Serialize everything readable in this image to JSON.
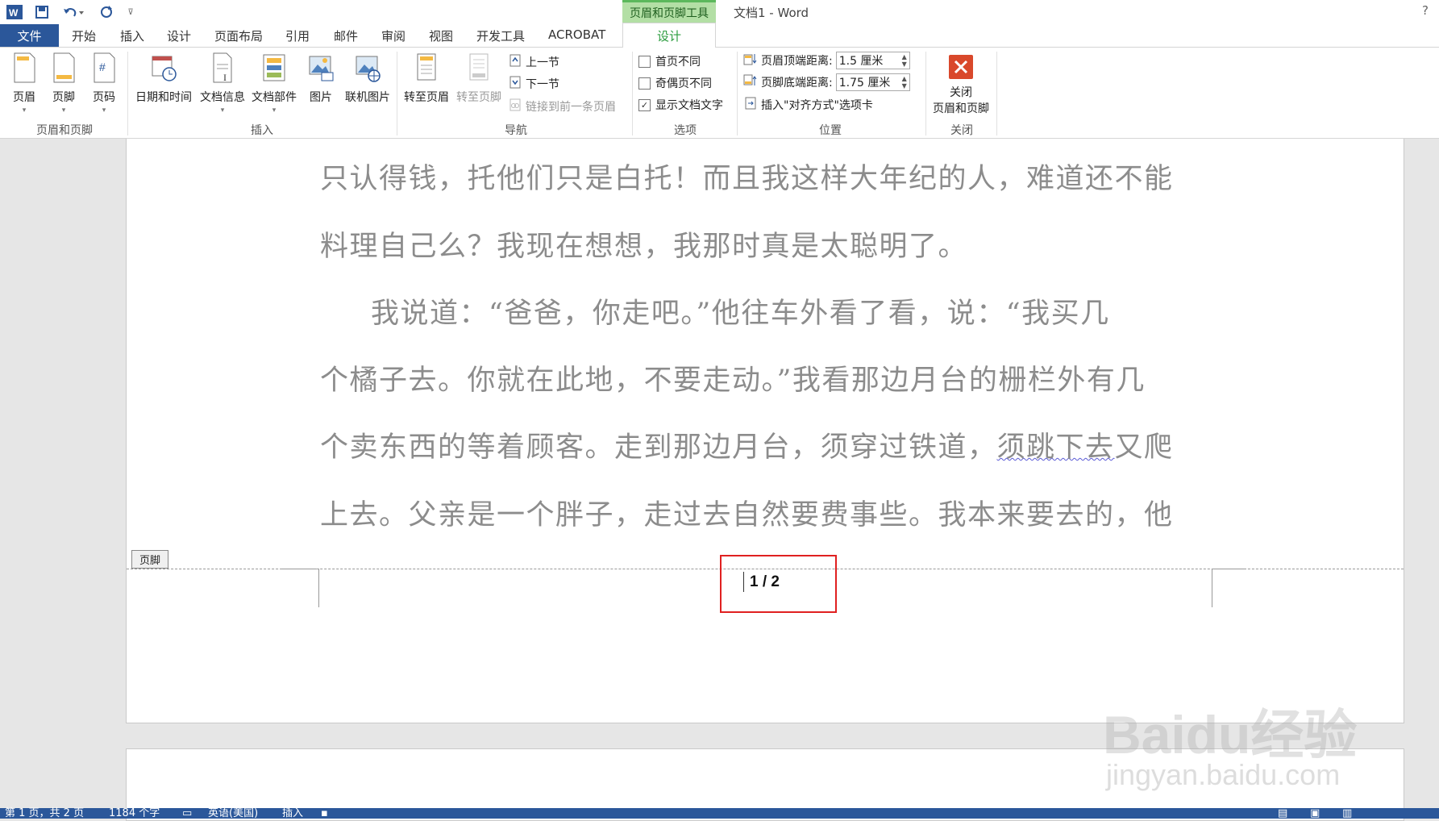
{
  "title_bar": {
    "app_title": "文档1 - Word",
    "context_group": "页眉和页脚工具",
    "help": "?",
    "qat": [
      "word-logo-icon",
      "save-icon",
      "undo-icon",
      "redo-icon",
      "customize-icon"
    ]
  },
  "tabs": {
    "file": "文件",
    "items": [
      "开始",
      "插入",
      "设计",
      "页面布局",
      "引用",
      "邮件",
      "审阅",
      "视图",
      "开发工具",
      "ACROBAT"
    ],
    "context_design": "设计"
  },
  "ribbon": {
    "hf_group": {
      "label": "页眉和页脚",
      "buttons": [
        "页眉",
        "页脚",
        "页码"
      ]
    },
    "insert_group": {
      "label": "插入",
      "buttons": [
        "日期和时间",
        "文档信息",
        "文档部件",
        "图片",
        "联机图片"
      ]
    },
    "nav_group": {
      "label": "导航",
      "goto_header": "转至页眉",
      "goto_footer": "转至页脚",
      "prev": "上一节",
      "next": "下一节",
      "link_prev": "链接到前一条页眉"
    },
    "options_group": {
      "label": "选项",
      "first_page": "首页不同",
      "odd_even": "奇偶页不同",
      "show_text": "显示文档文字",
      "show_text_checked": "✓"
    },
    "position_group": {
      "label": "位置",
      "header_top": "页眉顶端距离:",
      "header_top_value": "1.5 厘米",
      "footer_bottom": "页脚底端距离:",
      "footer_bottom_value": "1.75 厘米",
      "insert_align": "插入\"对齐方式\"选项卡"
    },
    "close_group": {
      "label": "关闭",
      "close_line1": "关闭",
      "close_line2": "页眉和页脚"
    }
  },
  "document": {
    "lines": [
      "只认得钱，托他们只是白托！而且我这样大年纪的人，难道还不能",
      "料理自己么？我现在想想，我那时真是太聪明了。",
      "我说道：“爸爸，你走吧。”他往车外看了看，说：“我买几",
      "个橘子去。你就在此地，不要走动。”我看那边月台的栅栏外有几",
      "上去。父亲是一个胖子，走过去自然要费事些。我本来要去的，他"
    ],
    "line5_pre": "个卖东西的等着顾客。走到那边月台，须穿过铁道，",
    "line5_squiggle": "须跳下去",
    "line5_post": "又爬",
    "footer_tag": "页脚",
    "page_number": "1 / 2"
  },
  "watermark": {
    "line1": "Baidu经验",
    "line2": "jingyan.baidu.com"
  },
  "status_bar": {
    "page": "第 1 页，共 2 页",
    "words": "1184 个字",
    "lang": "英语(美国)",
    "mode": "插入"
  }
}
